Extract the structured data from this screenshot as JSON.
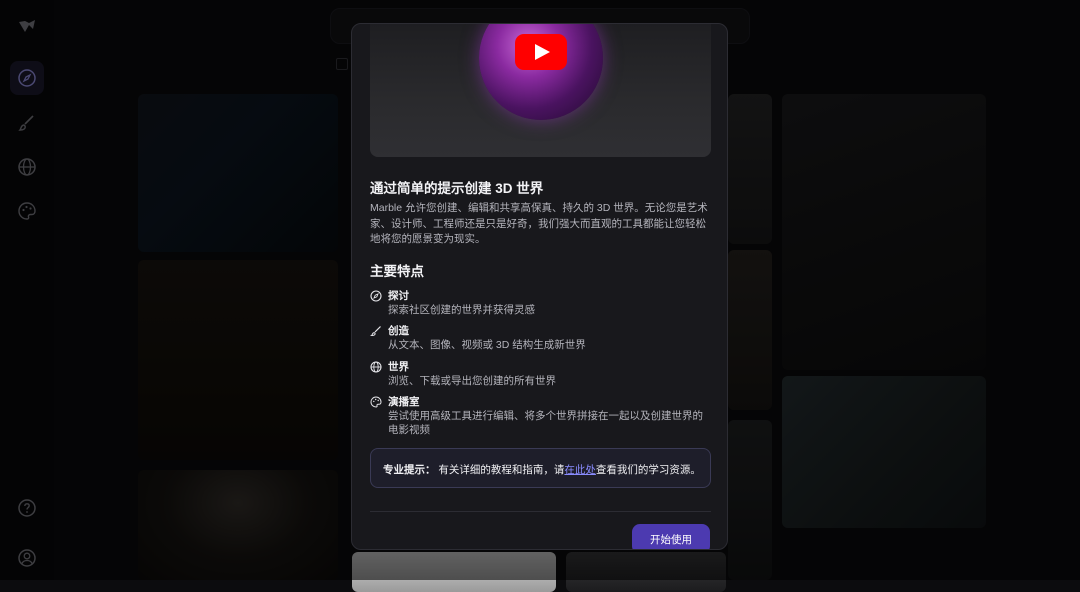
{
  "sidebar": {
    "icons": [
      "logo-icon",
      "compass-icon",
      "brush-icon",
      "globe-icon",
      "palette-icon",
      "help-icon",
      "user-icon"
    ]
  },
  "modal": {
    "title": "通过简单的提示创建 3D 世界",
    "description": "Marble 允许您创建、编辑和共享高保真、持久的 3D 世界。无论您是艺术家、设计师、工程师还是只是好奇，我们强大而直观的工具都能让您轻松地将您的愿景变为现实。",
    "features_heading": "主要特点",
    "features": [
      {
        "icon": "compass-icon",
        "title": "探讨",
        "desc": "探索社区创建的世界并获得灵感"
      },
      {
        "icon": "brush-icon",
        "title": "创造",
        "desc": "从文本、图像、视频或 3D 结构生成新世界"
      },
      {
        "icon": "globe-icon",
        "title": "世界",
        "desc": "浏览、下载或导出您创建的所有世界"
      },
      {
        "icon": "palette-icon",
        "title": "演播室",
        "desc": "尝试使用高级工具进行编辑、将多个世界拼接在一起以及创建世界的电影视频"
      }
    ],
    "tip": {
      "label": "专业提示：",
      "text_before": "有关详细的教程和指南，请",
      "link": "在此处",
      "text_after": "查看我们的学习资源。"
    },
    "start_button": "开始使用",
    "colors": {
      "accent": "#4c3ab0",
      "link": "#8a8cff",
      "youtube_red": "#ff0000"
    }
  }
}
